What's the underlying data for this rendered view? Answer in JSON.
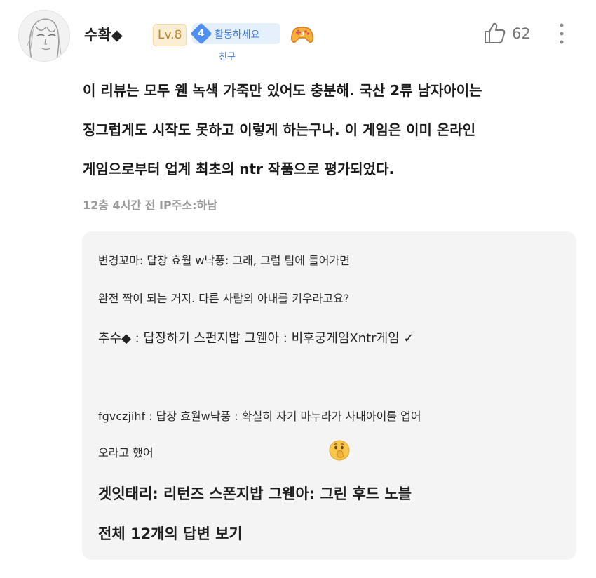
{
  "comment": {
    "username": "수확◆",
    "level_badge": "Lv.8",
    "activity": {
      "number": "4",
      "label": "활동하세요",
      "sublabel": "친구"
    },
    "like_count": "62",
    "body_lines": [
      "이 리뷰는 모두 웬 녹색 가죽만 있어도 충분해. 국산 2류 남자아이는",
      "징그럽게도 시작도 못하고 이렇게 하는구나. 이 게임은 이미 온라인",
      "게임으로부터 업계 최초의 ntr 작품으로 평가되었다."
    ],
    "meta": "12층 4시간 전 IP주소:하남"
  },
  "replies": {
    "r1_line1": "변경꼬마: 답장 효월 w낙풍: 그래, 그럼 팀에 들어가면",
    "r1_line2": "완전 짝이 되는 거지. 다른 사람의 아내를 키우라고요?",
    "r2": "추수◆ : 답장하기 스펀지밥 그웬아 : 비후궁게임Xntr게임 ✓",
    "r3_line1": "fgvczjihf : 답장 효월w낙풍 : 확실히 자기 마누라가 사내아이를 업어",
    "r3_line2": "오라고 했어",
    "r4": "겟잇태리: 리턴즈 스폰지밥 그웬아: 그린 후드 노블",
    "view_all": "전체 12개의 답변 보기"
  },
  "colors": {
    "accent_blue": "#4f8ff0",
    "level_gold": "#c0842b",
    "reply_bg": "#f4f4f5"
  }
}
